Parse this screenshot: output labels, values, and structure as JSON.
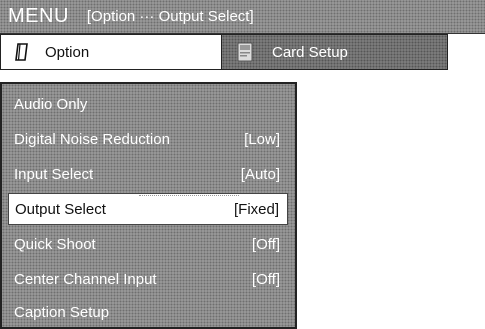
{
  "header": {
    "title": "MENU",
    "breadcrumb": "[Option ··· Output Select]"
  },
  "tabs": [
    {
      "label": "Option",
      "icon": "notebook-icon",
      "active": true
    },
    {
      "label": "Card Setup",
      "icon": "card-icon",
      "active": false
    }
  ],
  "menu": {
    "items": [
      {
        "label": "Audio Only",
        "value": ""
      },
      {
        "label": "Digital Noise Reduction",
        "value": "[Low]"
      },
      {
        "label": "Input Select",
        "value": "[Auto]"
      },
      {
        "label": "Output Select",
        "value": "[Fixed]",
        "selected": true
      },
      {
        "label": "Quick Shoot",
        "value": "[Off]"
      },
      {
        "label": "Center Channel Input",
        "value": "[Off]"
      },
      {
        "label": "Caption Setup",
        "value": ""
      }
    ]
  },
  "colors": {
    "panel_gray": "#8e8e8e",
    "dark_gray": "#737373",
    "text_light": "#ffffff",
    "text_dark": "#111111",
    "selected_bg": "#ffffff"
  }
}
